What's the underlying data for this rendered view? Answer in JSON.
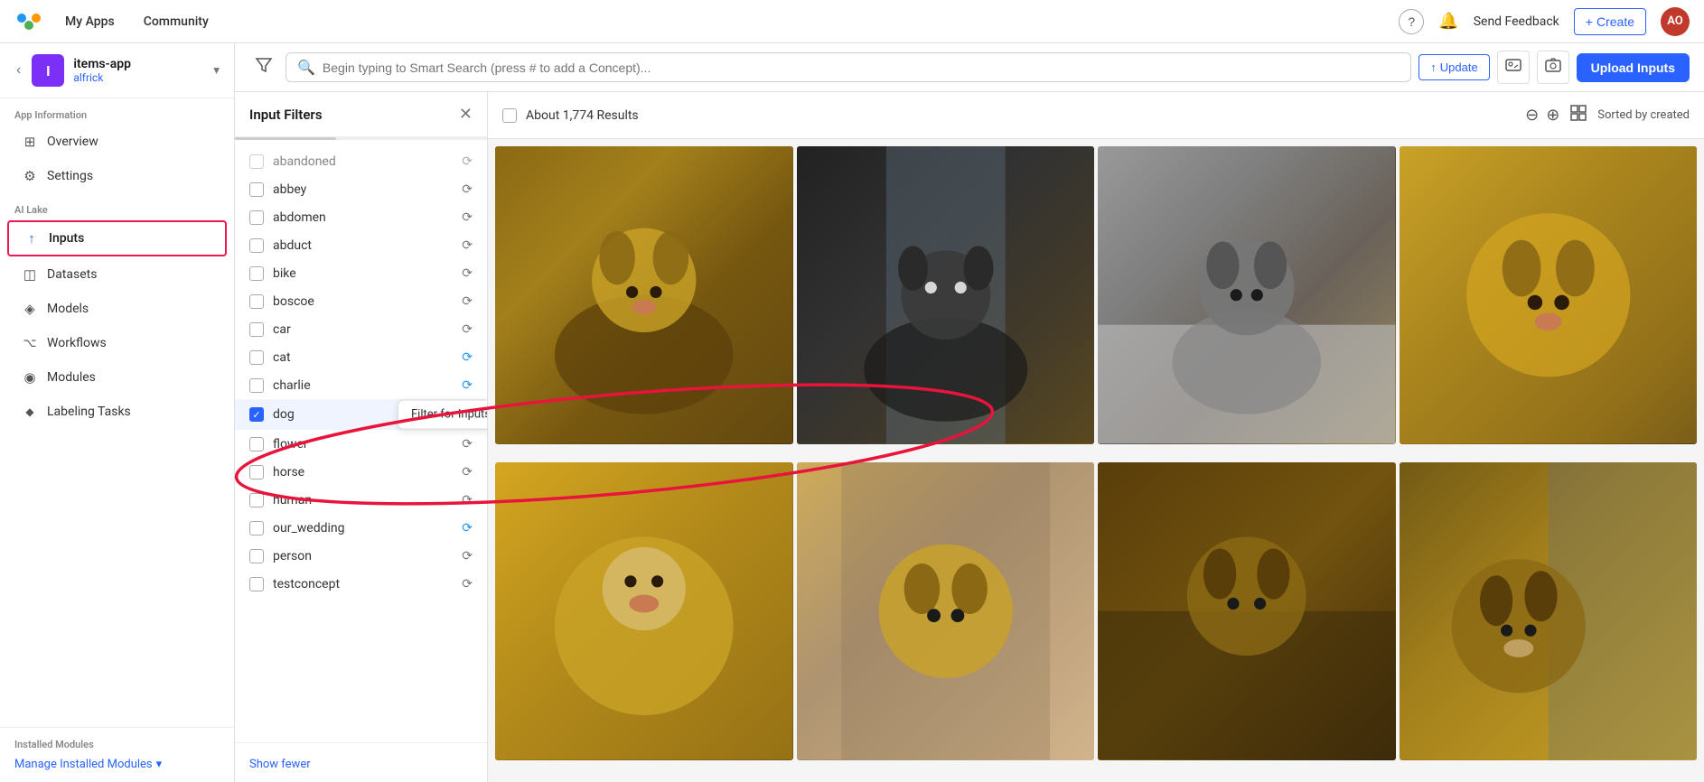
{
  "topnav": {
    "logo_text": "≋",
    "links": [
      {
        "label": "My Apps",
        "active": false
      },
      {
        "label": "Community",
        "active": false
      }
    ],
    "help_icon": "?",
    "bell_icon": "🔔",
    "send_feedback_label": "Send Feedback",
    "create_label": "Create",
    "avatar_initials": "AO"
  },
  "sidebar": {
    "app_icon_letter": "I",
    "app_name": "items-app",
    "app_user": "alfrick",
    "section_app_info": "App Information",
    "nav_items": [
      {
        "id": "overview",
        "label": "Overview",
        "icon": "⊞"
      },
      {
        "id": "settings",
        "label": "Settings",
        "icon": "⚙"
      }
    ],
    "section_ai_lake": "AI Lake",
    "ai_lake_items": [
      {
        "id": "inputs",
        "label": "Inputs",
        "icon": "↑",
        "active": true
      },
      {
        "id": "datasets",
        "label": "Datasets",
        "icon": "◫"
      },
      {
        "id": "models",
        "label": "Models",
        "icon": "◈"
      },
      {
        "id": "workflows",
        "label": "Workflows",
        "icon": "⌥"
      },
      {
        "id": "modules",
        "label": "Modules",
        "icon": "◉"
      },
      {
        "id": "labeling-tasks",
        "label": "Labeling Tasks",
        "icon": "◆"
      }
    ],
    "installed_modules_label": "Installed Modules",
    "manage_modules_label": "Manage Installed Modules"
  },
  "toolbar": {
    "search_placeholder": "Begin typing to Smart Search (press # to add a Concept)...",
    "update_label": "Update",
    "upload_label": "Upload Inputs"
  },
  "filter_panel": {
    "title": "Input Filters",
    "items": [
      {
        "id": "abandoned",
        "label": "abandoned",
        "checked": false
      },
      {
        "id": "abbey",
        "label": "abbey",
        "checked": false
      },
      {
        "id": "abdomen",
        "label": "abdomen",
        "checked": false
      },
      {
        "id": "abduct",
        "label": "abduct",
        "checked": false
      },
      {
        "id": "bike",
        "label": "bike",
        "checked": false
      },
      {
        "id": "boscoe",
        "label": "boscoe",
        "checked": false
      },
      {
        "id": "car",
        "label": "car",
        "checked": false
      },
      {
        "id": "cat",
        "label": "cat",
        "checked": false
      },
      {
        "id": "charlie",
        "label": "charlie",
        "checked": false
      },
      {
        "id": "dog",
        "label": "dog",
        "checked": true
      },
      {
        "id": "flower",
        "label": "flower",
        "checked": false
      },
      {
        "id": "horse",
        "label": "horse",
        "checked": false
      },
      {
        "id": "human",
        "label": "human",
        "checked": false
      },
      {
        "id": "our_wedding",
        "label": "our_wedding",
        "checked": false
      },
      {
        "id": "person",
        "label": "person",
        "checked": false
      },
      {
        "id": "testconcept",
        "label": "testconcept",
        "checked": false
      }
    ],
    "show_fewer_label": "Show fewer",
    "tooltip_text": "Filter for Inputs that do NOT match this value"
  },
  "results": {
    "count_text": "About 1,774 Results",
    "sort_label": "Sorted by created"
  },
  "images": [
    {
      "id": "img1",
      "color_class": "dog1"
    },
    {
      "id": "img2",
      "color_class": "dog2"
    },
    {
      "id": "img3",
      "color_class": "dog3"
    },
    {
      "id": "img4",
      "color_class": "dog4"
    },
    {
      "id": "img5",
      "color_class": "dog5"
    },
    {
      "id": "img6",
      "color_class": "dog6"
    },
    {
      "id": "img7",
      "color_class": "dog7"
    },
    {
      "id": "img8",
      "color_class": "dog8"
    }
  ]
}
